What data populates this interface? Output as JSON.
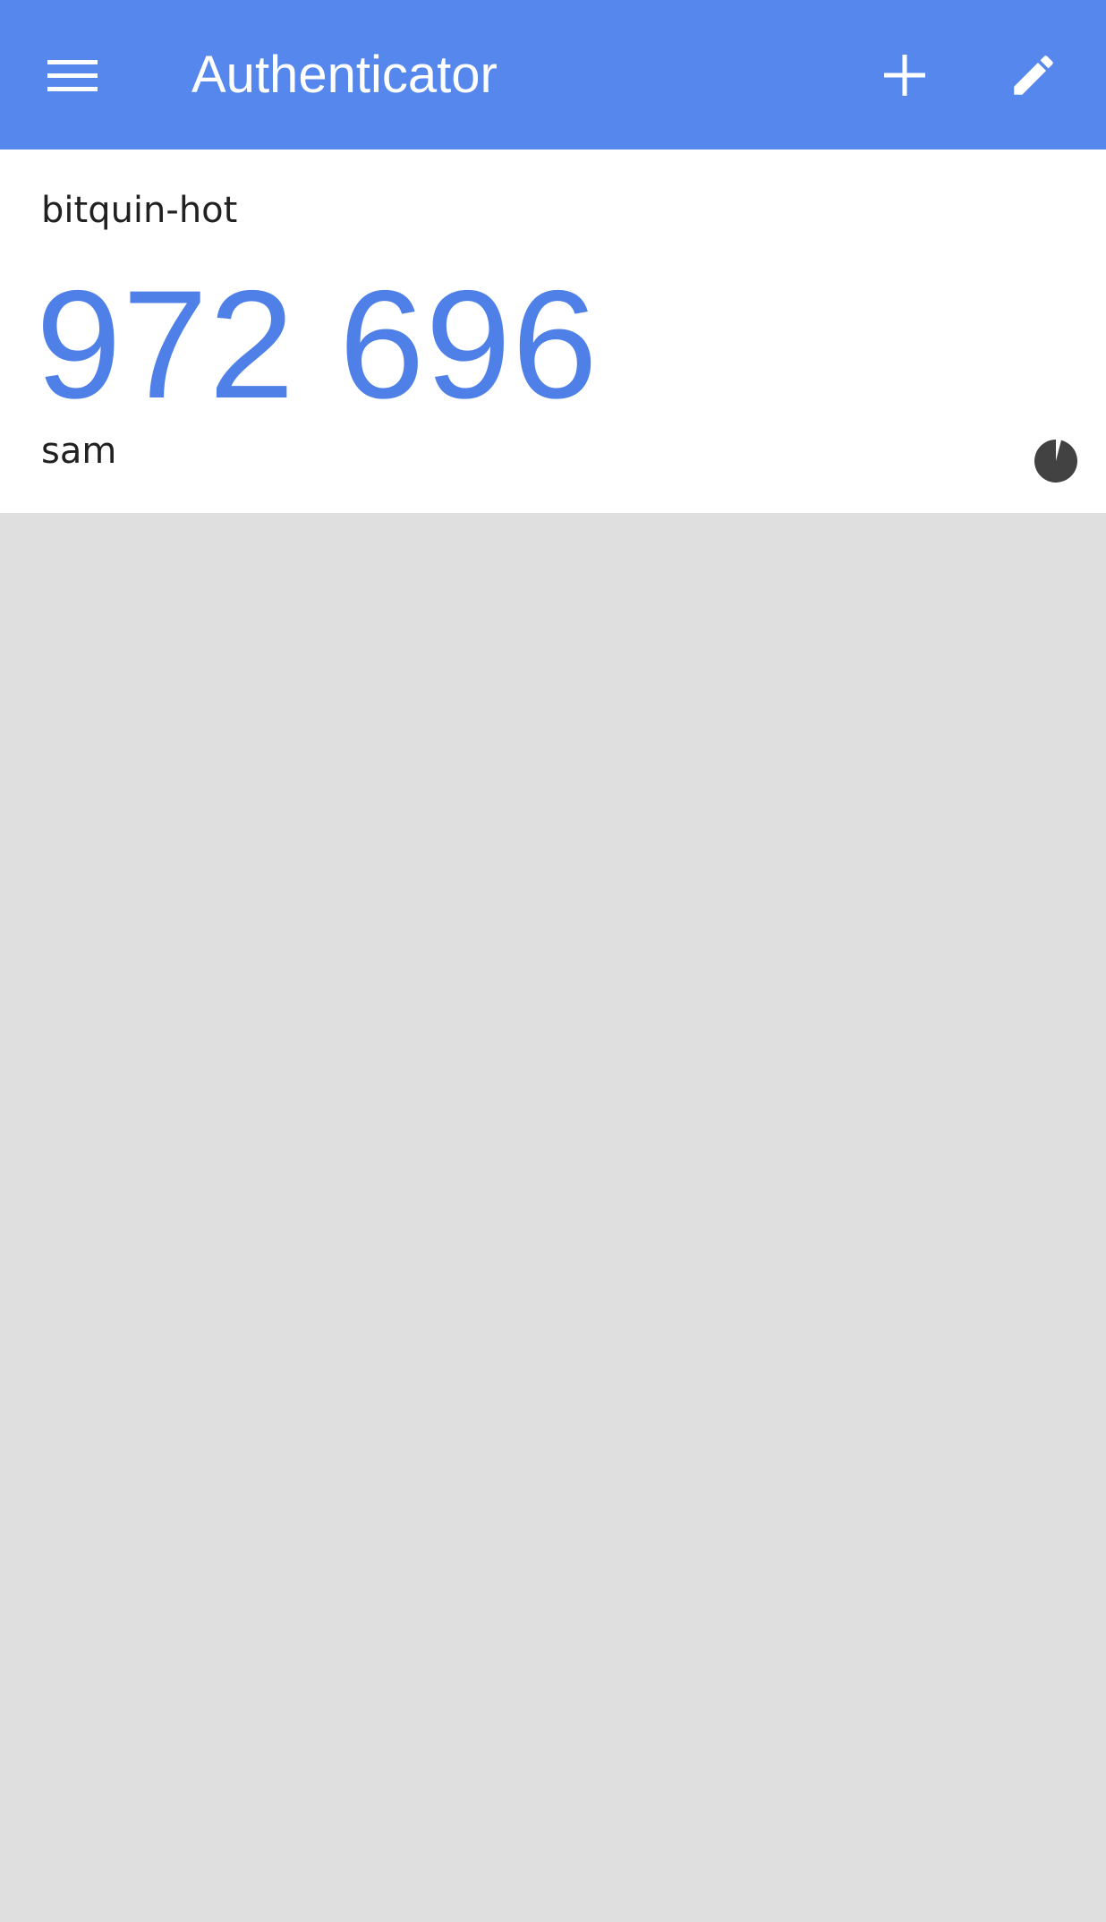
{
  "appbar": {
    "title": "Authenticator",
    "menu_icon": "menu-icon",
    "add_icon": "plus-icon",
    "edit_icon": "pencil-icon",
    "background_color": "#5587ed"
  },
  "accounts": [
    {
      "issuer": "bitquin-hot",
      "code": "972 696",
      "account": "sam",
      "countdown_remaining_fraction": 0.96,
      "code_color": "#4f80e8"
    }
  ]
}
